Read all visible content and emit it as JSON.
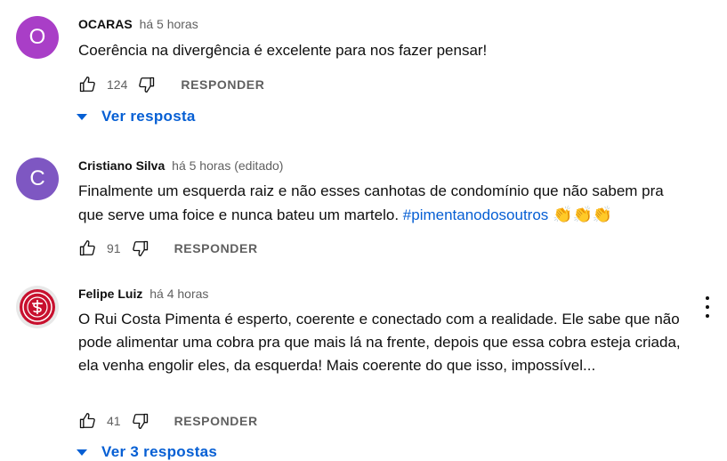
{
  "comments": [
    {
      "avatar_letter": "O",
      "avatar_color": "#a93ec7",
      "author": "OCARAS",
      "time": "há 5 horas",
      "text": "Coerência na divergência é excelente para nos fazer pensar!",
      "likes": "124",
      "reply_label": "RESPONDER",
      "replies_label": "Ver resposta"
    },
    {
      "avatar_letter": "C",
      "avatar_color": "#7e57c2",
      "author": "Cristiano Silva",
      "time": "há 5 horas (editado)",
      "text": "Finalmente um esquerda raiz e não esses canhotas de condomínio que não sabem pra que serve uma foice e nunca bateu um martelo.",
      "hashtag": "#pimentanodosoutros",
      "emoji": "👏👏👏",
      "likes": "91",
      "reply_label": "RESPONDER"
    },
    {
      "avatar_color": "#c8102e",
      "author": "Felipe Luiz",
      "time": "há 4 horas",
      "text": "O Rui Costa Pimenta é esperto, coerente e conectado com a realidade. Ele sabe que não pode alimentar uma cobra pra que mais lá na frente, depois que essa cobra esteja criada, ela venha engolir eles, da esquerda! Mais coerente do que isso, impossível...",
      "likes": "41",
      "reply_label": "RESPONDER",
      "replies_label": "Ver 3 respostas"
    }
  ]
}
